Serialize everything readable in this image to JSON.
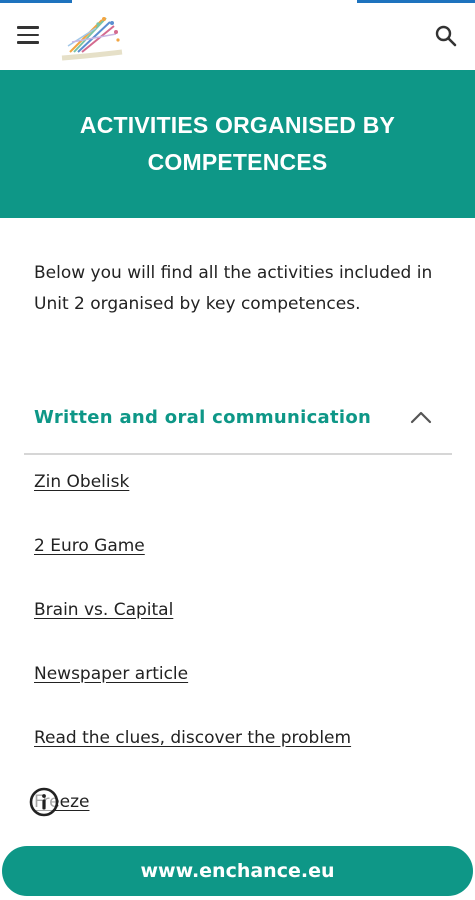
{
  "header": {
    "menu_icon": "hamburger-menu-icon",
    "logo": "enchance-logo",
    "search_icon": "search-icon"
  },
  "hero": {
    "title": "ACTIVITIES ORGANISED BY COMPETENCES",
    "background": "#0e9787"
  },
  "intro": {
    "text": "Below you will find all the activities included in Unit 2 organised by key competences."
  },
  "accordion": {
    "title": "Written and oral communication",
    "icon": "chevron-up-icon",
    "expanded": true,
    "items": [
      {
        "label": "Zin Obelisk"
      },
      {
        "label": "2 Euro Game"
      },
      {
        "label": "Brain vs. Capital"
      },
      {
        "label": "Newspaper article"
      },
      {
        "label": "Read the clues, discover the problem"
      },
      {
        "label": "Freeze"
      }
    ]
  },
  "footer": {
    "info_icon": "info-icon",
    "website_label": "www.enchance.eu"
  },
  "colors": {
    "accent": "#0e9787",
    "top_bar_accent": "#1e73be"
  }
}
